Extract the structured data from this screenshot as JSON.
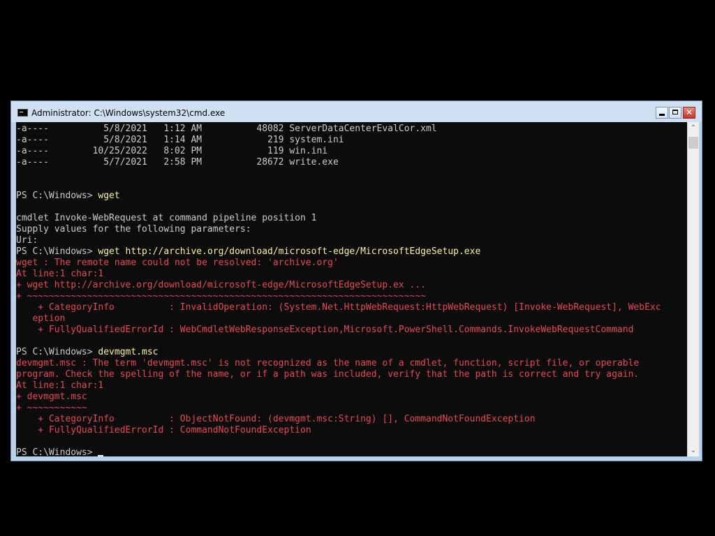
{
  "window": {
    "title": "Administrator: C:\\Windows\\system32\\cmd.exe",
    "close_glyph": "✕"
  },
  "console": {
    "lines": [
      {
        "text": "-a----          5/8/2021   1:12 AM          48082 ServerDataCenterEvalCor.xml",
        "color": "white"
      },
      {
        "text": "-a----          5/8/2021   1:14 AM            219 system.ini",
        "color": "white"
      },
      {
        "text": "-a----        10/25/2022   8:02 PM            119 win.ini",
        "color": "white"
      },
      {
        "text": "-a----          5/7/2021   2:58 PM          28672 write.exe",
        "color": "white"
      },
      {
        "text": "",
        "color": "white"
      },
      {
        "text": "",
        "color": "white"
      },
      {
        "prompt": "PS C:\\Windows> ",
        "cmd": "wget",
        "color": "white"
      },
      {
        "text": "",
        "color": "white"
      },
      {
        "text": "cmdlet Invoke-WebRequest at command pipeline position 1",
        "color": "white"
      },
      {
        "text": "Supply values for the following parameters:",
        "color": "white"
      },
      {
        "text": "Uri:",
        "color": "white"
      },
      {
        "prompt": "PS C:\\Windows> ",
        "cmd": "wget http://archive.org/download/microsoft-edge/MicrosoftEdgeSetup.exe",
        "color": "white"
      },
      {
        "text": "wget : The remote name could not be resolved: 'archive.org'",
        "color": "red"
      },
      {
        "text": "At line:1 char:1",
        "color": "red"
      },
      {
        "text": "+ wget http://archive.org/download/microsoft-edge/MicrosoftEdgeSetup.ex ...",
        "color": "red"
      },
      {
        "text": "+ ~~~~~~~~~~~~~~~~~~~~~~~~~~~~~~~~~~~~~~~~~~~~~~~~~~~~~~~~~~~~~~~~~~~~~~~~~",
        "color": "red"
      },
      {
        "text": "    + CategoryInfo          : InvalidOperation: (System.Net.HttpWebRequest:HttpWebRequest) [Invoke-WebRequest], WebExc",
        "color": "red"
      },
      {
        "text": "   eption",
        "color": "red"
      },
      {
        "text": "    + FullyQualifiedErrorId : WebCmdletWebResponseException,Microsoft.PowerShell.Commands.InvokeWebRequestCommand",
        "color": "red"
      },
      {
        "text": "",
        "color": "white"
      },
      {
        "prompt": "PS C:\\Windows> ",
        "cmd": "devmgmt.msc",
        "color": "white"
      },
      {
        "text": "devmgmt.msc : The term 'devmgmt.msc' is not recognized as the name of a cmdlet, function, script file, or operable",
        "color": "red"
      },
      {
        "text": "program. Check the spelling of the name, or if a path was included, verify that the path is correct and try again.",
        "color": "red"
      },
      {
        "text": "At line:1 char:1",
        "color": "red"
      },
      {
        "text": "+ devmgmt.msc",
        "color": "red"
      },
      {
        "text": "+ ~~~~~~~~~~~",
        "color": "red"
      },
      {
        "text": "    + CategoryInfo          : ObjectNotFound: (devmgmt.msc:String) [], CommandNotFoundException",
        "color": "red"
      },
      {
        "text": "    + FullyQualifiedErrorId : CommandNotFoundException",
        "color": "red"
      },
      {
        "text": "",
        "color": "white"
      },
      {
        "prompt": "PS C:\\Windows> ",
        "cmd": "",
        "cursor": true,
        "color": "white"
      }
    ]
  },
  "scrollbar": {
    "up_glyph": "⌃",
    "down_glyph": "⌄"
  }
}
